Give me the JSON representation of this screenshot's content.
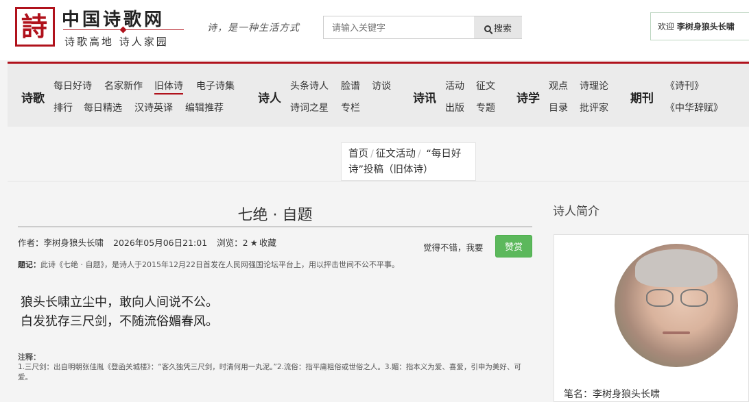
{
  "header": {
    "logo_glyph": "詩",
    "site_name": "中国诗歌网",
    "site_sub": "诗歌高地 诗人家园",
    "slogan": "诗，是一种生活方式",
    "search": {
      "placeholder": "请输入关键字",
      "button_label": "搜索"
    },
    "welcome": {
      "prefix": "欢迎",
      "user": "李树身狼头长啸"
    }
  },
  "nav": {
    "groups": [
      {
        "category": "诗歌",
        "links": [
          "每日好诗",
          "名家新作",
          "旧体诗",
          "电子诗集",
          "排行",
          "每日精选",
          "汉诗英译",
          "编辑推荐"
        ],
        "active": "旧体诗"
      },
      {
        "category": "诗人",
        "links": [
          "头条诗人",
          "脸谱",
          "访谈",
          "诗词之星",
          "专栏"
        ]
      },
      {
        "category": "诗讯",
        "links": [
          "活动",
          "征文",
          "出版",
          "专题"
        ]
      },
      {
        "category": "诗学",
        "links": [
          "观点",
          "诗理论",
          "目录",
          "批评家"
        ]
      },
      {
        "category": "期刊",
        "links": [
          "《诗刊》",
          "《中华辞赋》"
        ]
      }
    ]
  },
  "breadcrumb": {
    "home": "首页",
    "section": "征文活动",
    "current": "“每日好诗”投稿（旧体诗）"
  },
  "article": {
    "title": "七绝 · 自题",
    "author_label": "作者：李树身狼头长啸",
    "date": "2026年05月06日21:01",
    "views": "浏览：2",
    "favorite": "收藏",
    "like_text": "觉得不错，我要",
    "reward_button": "赞赏",
    "dedication_label": "题记：",
    "dedication": "此诗《七绝 · 自题》，是诗人于2015年12月22日首发在人民网强国论坛平台上，用以抨击世间不公不平事。",
    "poem_lines": [
      "狼头长啸立尘中，敢向人间说不公。",
      "白发犹存三尺剑，不随流俗媚春风。"
    ],
    "notes_label": "注释：",
    "notes": "1.三尺剑：出自明朝张佳胤《登函关城楼》：“客久独凭三尺剑，时清何用一丸泥。”2.流俗：指平庸粗俗或世俗之人。3.媚：指本义为爱、喜爱，引申为美好、可爱。"
  },
  "profile": {
    "heading": "诗人简介",
    "pen_name": "笔名：李树身狼头长啸"
  },
  "colors": {
    "brand_red": "#b0121c",
    "reward_green": "#5cb85c"
  }
}
